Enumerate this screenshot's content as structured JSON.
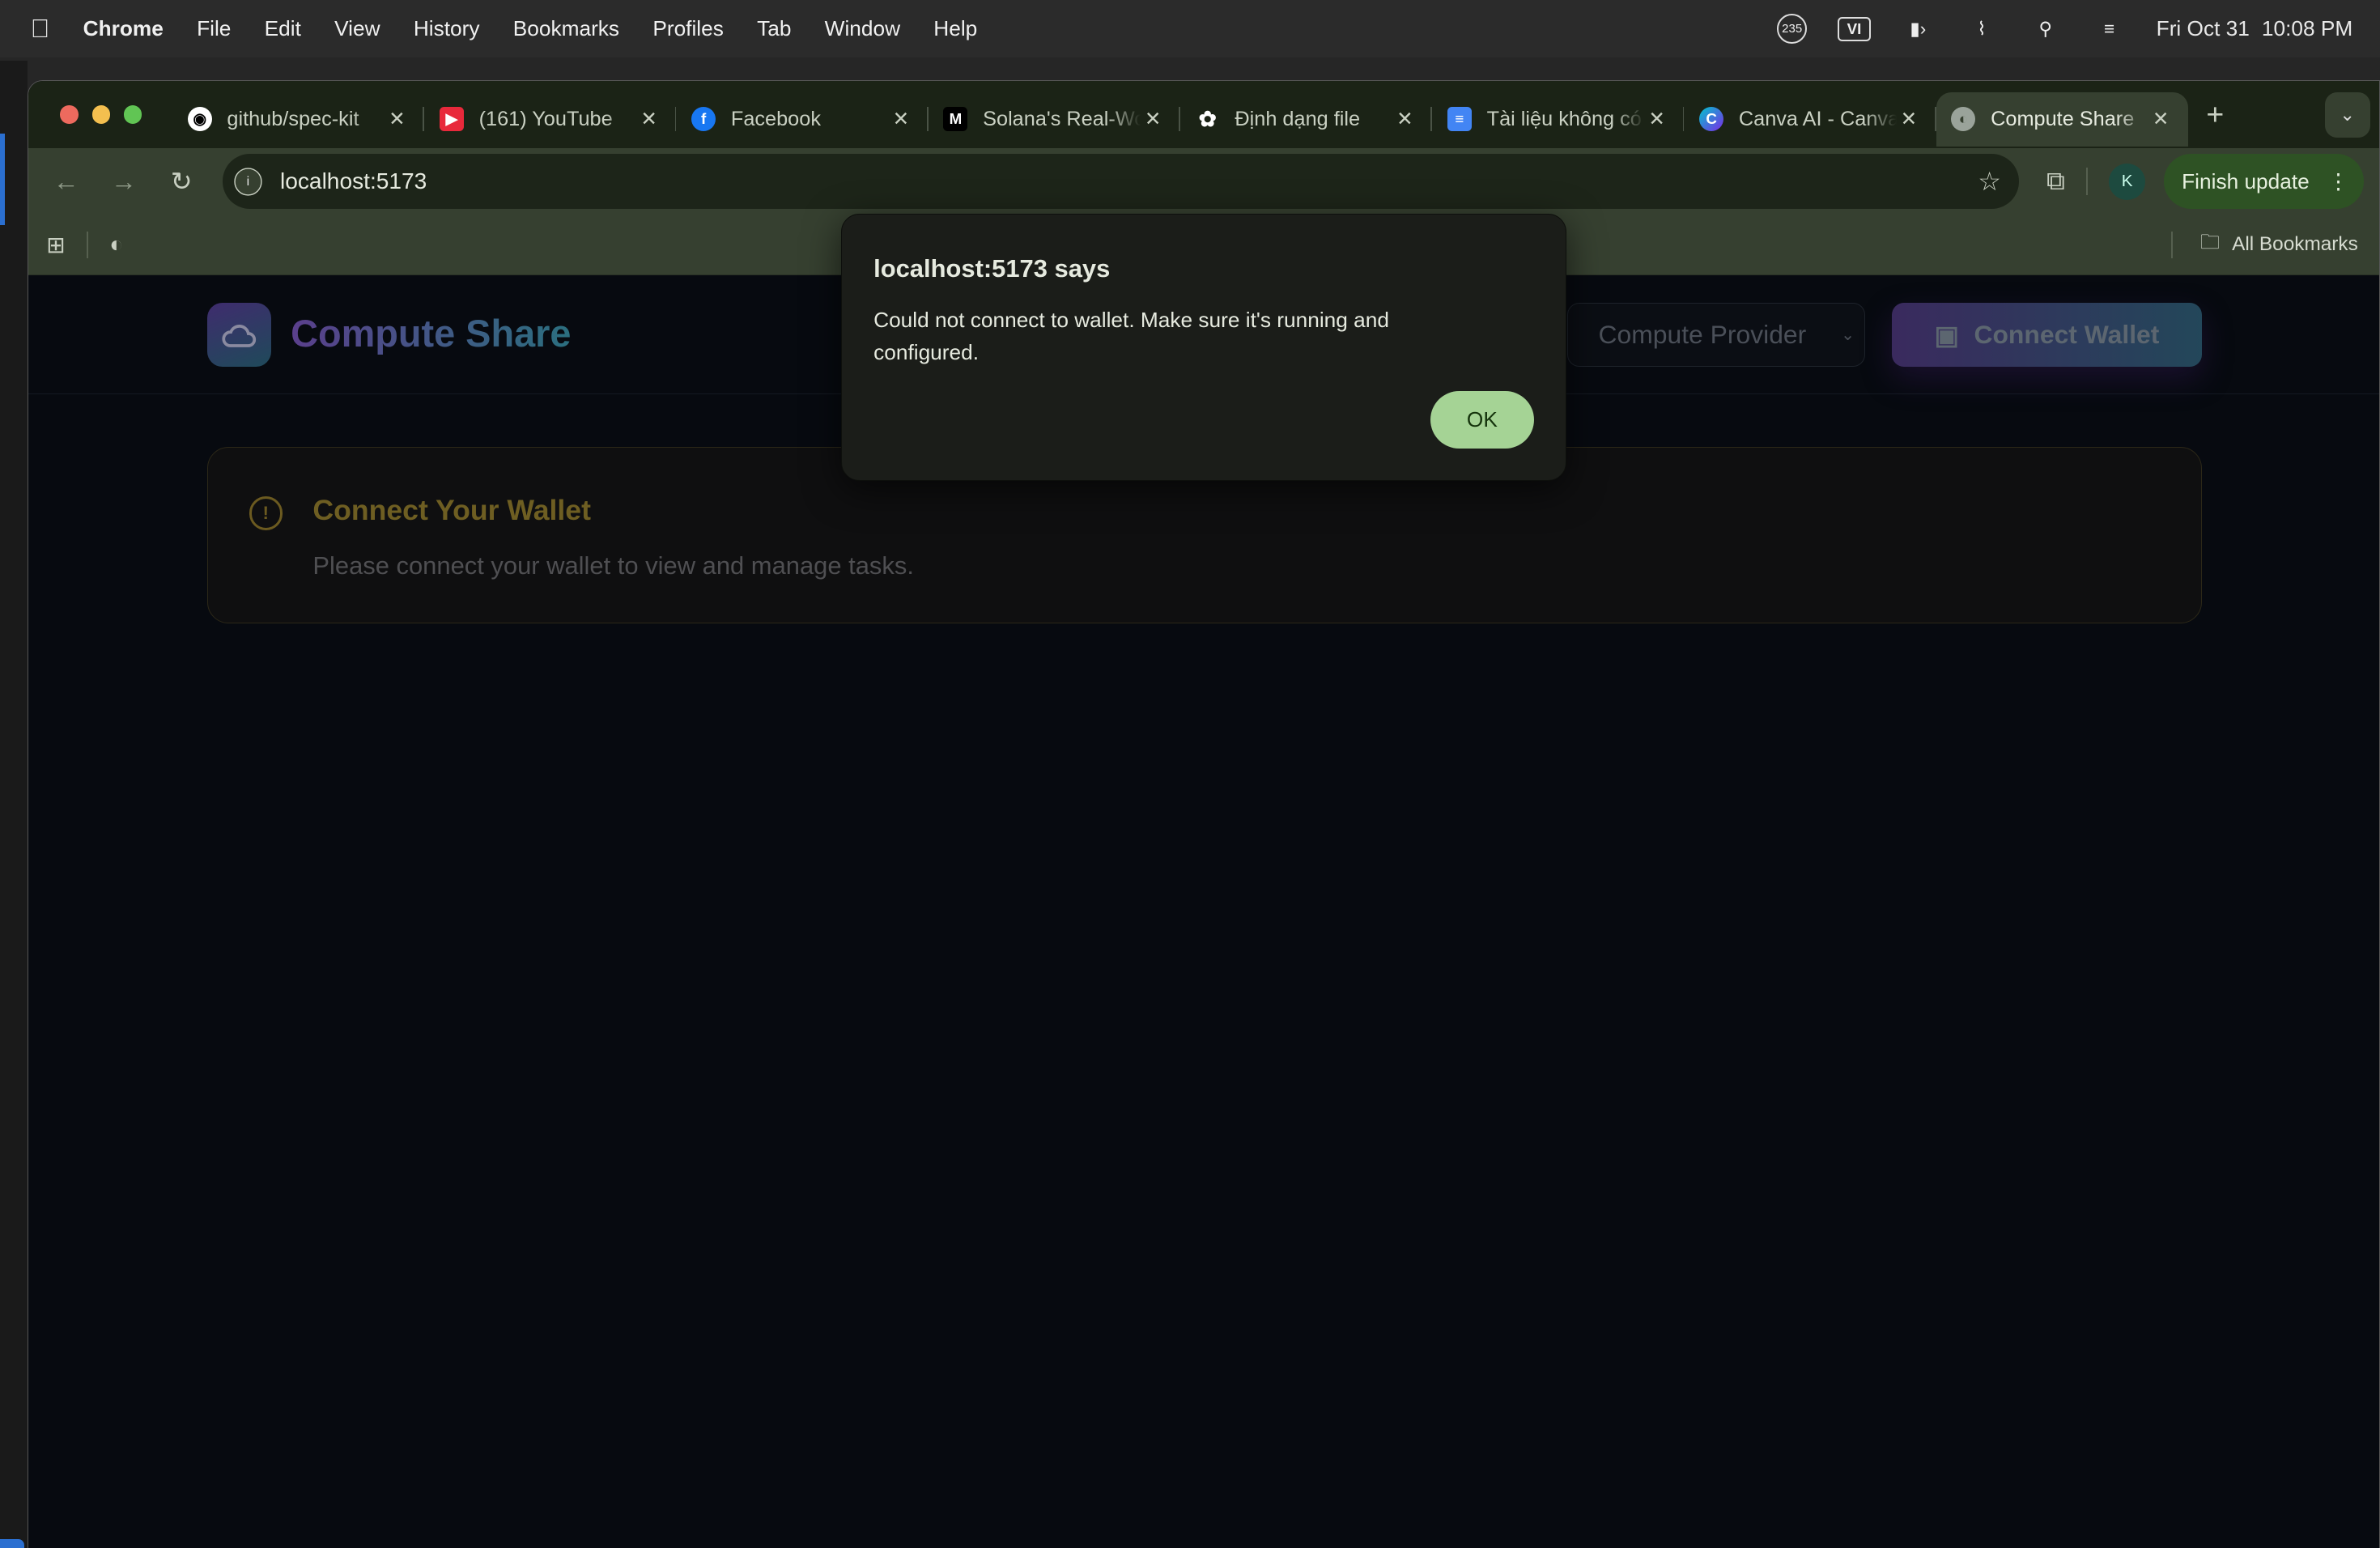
{
  "menubar": {
    "app": "Chrome",
    "items": [
      "File",
      "Edit",
      "View",
      "History",
      "Bookmarks",
      "Profiles",
      "Tab",
      "Window",
      "Help"
    ],
    "status": {
      "notification_count": "235",
      "input_source": "VI",
      "date": "Fri Oct 31",
      "time": "10:08 PM"
    }
  },
  "tabs": [
    {
      "title": "github/spec-kit",
      "icon": "github-icon",
      "color": "#ffffff"
    },
    {
      "title": "(161) YouTube",
      "icon": "youtube-icon",
      "color": "#e8293b"
    },
    {
      "title": "Facebook",
      "icon": "facebook-icon",
      "color": "#1877f2"
    },
    {
      "title": "Solana's Real-World",
      "icon": "medium-icon",
      "color": "#000000"
    },
    {
      "title": "Định dạng file",
      "icon": "chatgpt-icon",
      "color": "#ffffff"
    },
    {
      "title": "Tài liệu không có tiêu đề",
      "icon": "google-docs-icon",
      "color": "#4285f4"
    },
    {
      "title": "Canva AI - Canva",
      "icon": "canva-icon",
      "color": "#7d2ae8"
    },
    {
      "title": "Compute Share",
      "icon": "globe-icon",
      "color": "#9aa39a",
      "active": true
    }
  ],
  "toolbar": {
    "url": "localhost:5173",
    "profile_initial": "K",
    "finish_update": "Finish update"
  },
  "bookmarks": {
    "all_bookmarks": "All Bookmarks"
  },
  "app": {
    "brand": "Compute Share",
    "role_select": "Compute Provider",
    "connect_wallet": "Connect Wallet",
    "card_title": "Connect Your Wallet",
    "card_text": "Please connect your wallet to view and manage tasks."
  },
  "dialog": {
    "title": "localhost:5173 says",
    "message": "Could not connect to wallet. Make sure it's running and configured.",
    "ok": "OK"
  }
}
